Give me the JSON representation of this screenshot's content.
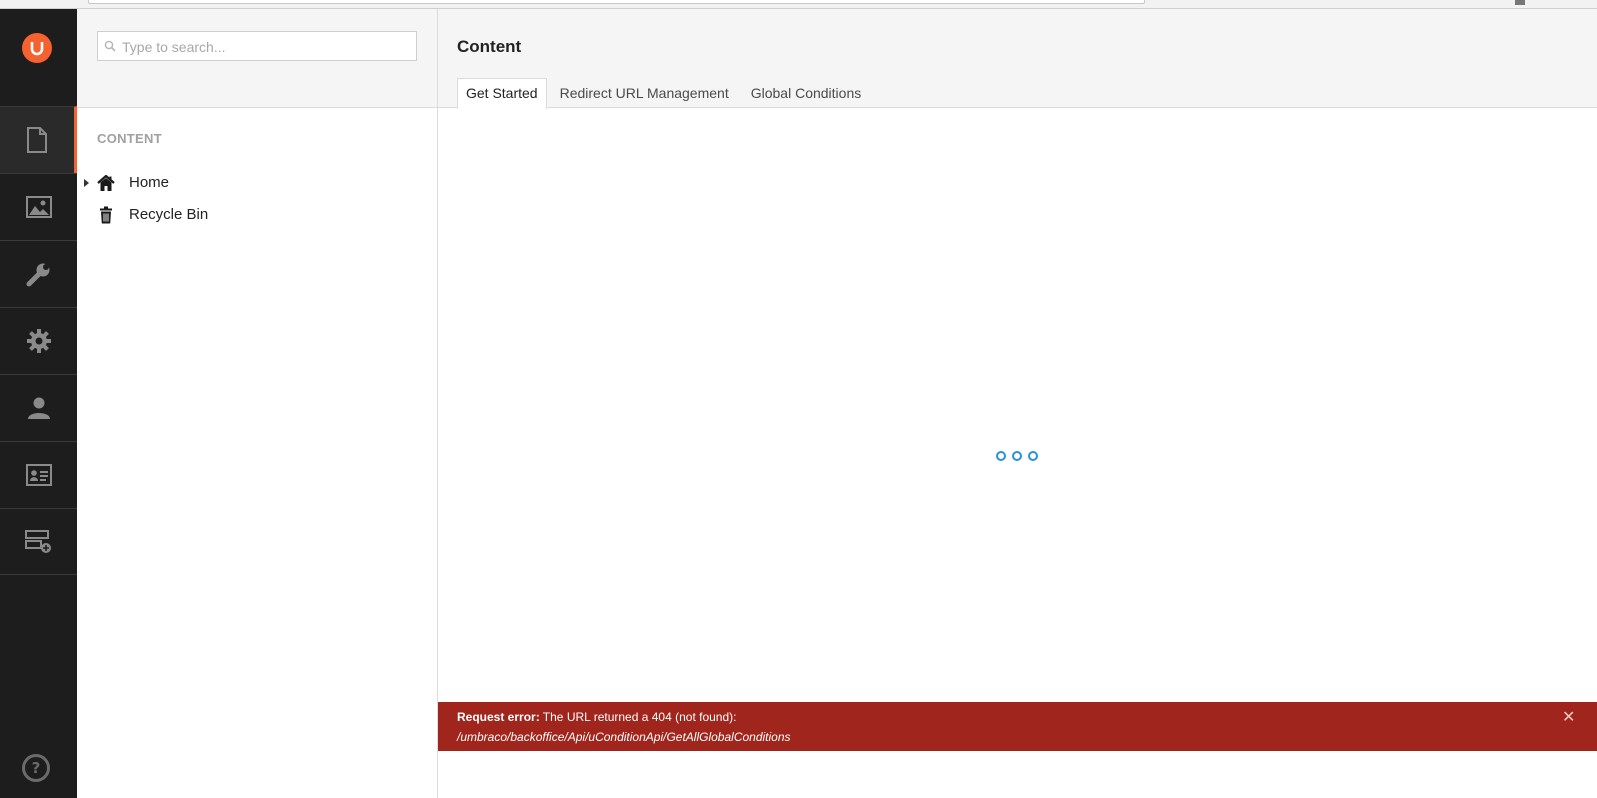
{
  "search": {
    "placeholder": "Type to search..."
  },
  "tree": {
    "title": "CONTENT",
    "items": [
      {
        "label": "Home",
        "icon": "home-icon",
        "has_children": true
      },
      {
        "label": "Recycle Bin",
        "icon": "trash-icon",
        "has_children": false
      }
    ]
  },
  "sections": [
    {
      "name": "content",
      "icon": "document-icon",
      "active": true
    },
    {
      "name": "media",
      "icon": "image-icon",
      "active": false
    },
    {
      "name": "settings",
      "icon": "wrench-icon",
      "active": false
    },
    {
      "name": "developer",
      "icon": "gear-icon",
      "active": false
    },
    {
      "name": "users",
      "icon": "user-icon",
      "active": false
    },
    {
      "name": "members",
      "icon": "id-card-icon",
      "active": false
    },
    {
      "name": "forms",
      "icon": "form-add-icon",
      "active": false
    }
  ],
  "main": {
    "title": "Content",
    "tabs": [
      {
        "label": "Get Started",
        "active": true
      },
      {
        "label": "Redirect URL Management",
        "active": false
      },
      {
        "label": "Global Conditions",
        "active": false
      }
    ]
  },
  "error": {
    "label": "Request error:",
    "message": " The URL returned a 404 (not found):",
    "url": "/umbraco/backoffice/Api/uConditionApi/GetAllGlobalConditions"
  },
  "help": {
    "glyph": "?"
  },
  "colors": {
    "brand": "#f5612f",
    "nav_background": "#1d1d1d",
    "error_background": "#a0251c",
    "loader": "#2a8fe0"
  }
}
